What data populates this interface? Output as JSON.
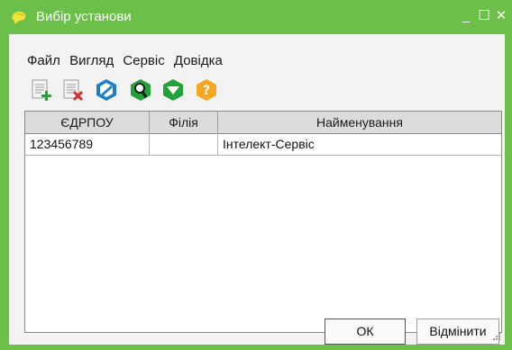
{
  "window": {
    "title": "Вибір установи",
    "minimize": "_",
    "maximize": "☐",
    "close": "✕"
  },
  "menu": [
    "Файл",
    "Вигляд",
    "Сервіс",
    "Довідка"
  ],
  "toolbar": [
    {
      "icon": "add-document-icon",
      "color": "#2e9e3a"
    },
    {
      "icon": "delete-document-icon",
      "color": "#d32f2f"
    },
    {
      "icon": "edit-hex-icon",
      "color": "#1f7fc8"
    },
    {
      "icon": "search-hex-icon",
      "color": "#22a33a"
    },
    {
      "icon": "filter-hex-icon",
      "color": "#22a33a"
    },
    {
      "icon": "help-hex-icon",
      "color": "#f5a623"
    }
  ],
  "table": {
    "columns": [
      "ЄДРПОУ",
      "Філія",
      "Найменування"
    ],
    "rows": [
      [
        "123456789",
        "",
        "Інтелект-Сервіс"
      ]
    ]
  },
  "buttons": {
    "ok": "ОК",
    "cancel": "Відмінити"
  },
  "colors": {
    "frame": "#6cc04a",
    "header": "#dcdcdc",
    "background": "#f3f3f3"
  }
}
